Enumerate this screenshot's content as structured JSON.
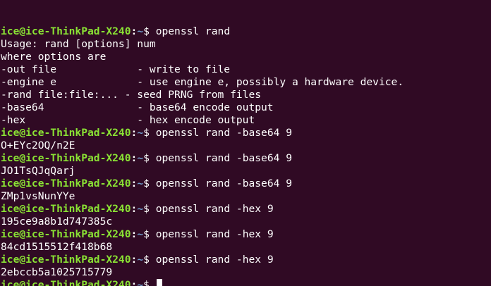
{
  "terminal": {
    "colors": {
      "background": "#300a24",
      "prompt_user": "#8ae234",
      "prompt_path": "#729fcf",
      "text": "#ffffff"
    },
    "prompt": {
      "user_host": "ice@ice-ThinkPad-X240",
      "colon": ":",
      "path": "~",
      "sign": "$ "
    },
    "lines": [
      {
        "type": "prompt",
        "command": "openssl rand"
      },
      {
        "type": "output",
        "text": "Usage: rand [options] num"
      },
      {
        "type": "output",
        "text": "where options are"
      },
      {
        "type": "output",
        "text": "-out file             - write to file"
      },
      {
        "type": "output",
        "text": "-engine e             - use engine e, possibly a hardware device."
      },
      {
        "type": "output",
        "text": "-rand file:file:... - seed PRNG from files"
      },
      {
        "type": "output",
        "text": "-base64               - base64 encode output"
      },
      {
        "type": "output",
        "text": "-hex                  - hex encode output"
      },
      {
        "type": "prompt",
        "command": "openssl rand -base64 9"
      },
      {
        "type": "output",
        "text": "O+EYc2OQ/n2E"
      },
      {
        "type": "prompt",
        "command": "openssl rand -base64 9"
      },
      {
        "type": "output",
        "text": "JO1TsQJqQarj"
      },
      {
        "type": "prompt",
        "command": "openssl rand -base64 9"
      },
      {
        "type": "output",
        "text": "ZMp1vsNunYYe"
      },
      {
        "type": "prompt",
        "command": "openssl rand -hex 9"
      },
      {
        "type": "output",
        "text": "195ce9a8b1d747385c"
      },
      {
        "type": "prompt",
        "command": "openssl rand -hex 9"
      },
      {
        "type": "output",
        "text": "84cd1515512f418b68"
      },
      {
        "type": "prompt",
        "command": "openssl rand -hex 9"
      },
      {
        "type": "output",
        "text": "2ebccb5a1025715779"
      },
      {
        "type": "prompt",
        "command": "",
        "cursor": true
      }
    ]
  }
}
